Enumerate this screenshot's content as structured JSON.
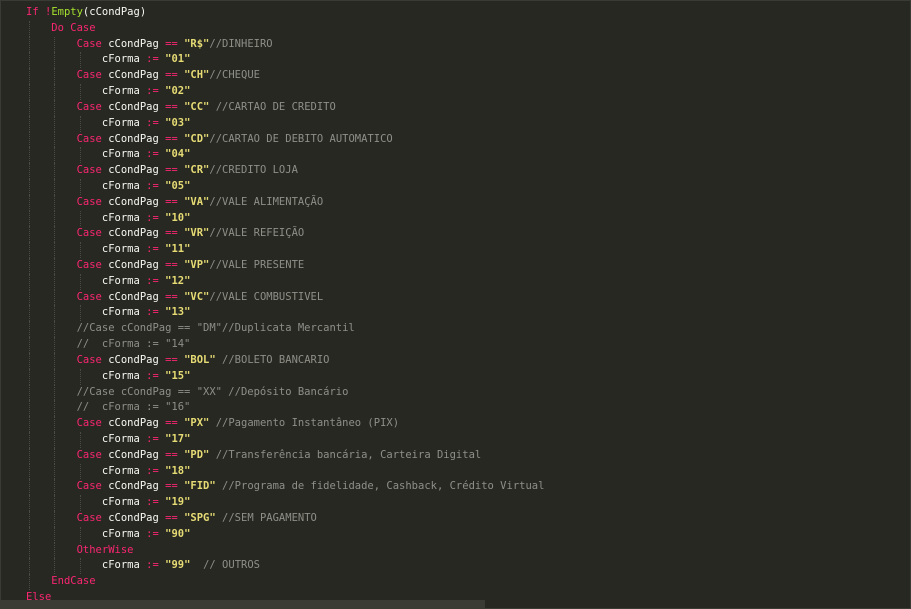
{
  "editor": {
    "lines": [
      {
        "indent": 1,
        "tokens": [
          [
            "kw",
            "If"
          ],
          [
            "id",
            " "
          ],
          [
            "op",
            "!"
          ],
          [
            "fn",
            "Empty"
          ],
          [
            "id",
            "(cCondPag)"
          ]
        ]
      },
      {
        "indent": 2,
        "tokens": [
          [
            "kw",
            "Do Case"
          ]
        ]
      },
      {
        "indent": 3,
        "tokens": [
          [
            "kw",
            "Case"
          ],
          [
            "id",
            " cCondPag "
          ],
          [
            "op",
            "=="
          ],
          [
            "id",
            " "
          ],
          [
            "str",
            "\"R$\""
          ],
          [
            "cm",
            "//DINHEIRO"
          ]
        ]
      },
      {
        "indent": 4,
        "tokens": [
          [
            "id",
            "cForma "
          ],
          [
            "op",
            ":="
          ],
          [
            "id",
            " "
          ],
          [
            "str",
            "\"01\""
          ]
        ]
      },
      {
        "indent": 3,
        "tokens": [
          [
            "kw",
            "Case"
          ],
          [
            "id",
            " cCondPag "
          ],
          [
            "op",
            "=="
          ],
          [
            "id",
            " "
          ],
          [
            "str",
            "\"CH\""
          ],
          [
            "cm",
            "//CHEQUE"
          ]
        ]
      },
      {
        "indent": 4,
        "tokens": [
          [
            "id",
            "cForma "
          ],
          [
            "op",
            ":="
          ],
          [
            "id",
            " "
          ],
          [
            "str",
            "\"02\""
          ]
        ]
      },
      {
        "indent": 3,
        "tokens": [
          [
            "kw",
            "Case"
          ],
          [
            "id",
            " cCondPag "
          ],
          [
            "op",
            "=="
          ],
          [
            "id",
            " "
          ],
          [
            "str",
            "\"CC\""
          ],
          [
            "id",
            " "
          ],
          [
            "cm",
            "//CARTAO DE CREDITO"
          ]
        ]
      },
      {
        "indent": 4,
        "tokens": [
          [
            "id",
            "cForma "
          ],
          [
            "op",
            ":="
          ],
          [
            "id",
            " "
          ],
          [
            "str",
            "\"03\""
          ]
        ]
      },
      {
        "indent": 3,
        "tokens": [
          [
            "kw",
            "Case"
          ],
          [
            "id",
            " cCondPag "
          ],
          [
            "op",
            "=="
          ],
          [
            "id",
            " "
          ],
          [
            "str",
            "\"CD\""
          ],
          [
            "cm",
            "//CARTAO DE DEBITO AUTOMATICO"
          ]
        ]
      },
      {
        "indent": 4,
        "tokens": [
          [
            "id",
            "cForma "
          ],
          [
            "op",
            ":="
          ],
          [
            "id",
            " "
          ],
          [
            "str",
            "\"04\""
          ]
        ]
      },
      {
        "indent": 3,
        "tokens": [
          [
            "kw",
            "Case"
          ],
          [
            "id",
            " cCondPag "
          ],
          [
            "op",
            "=="
          ],
          [
            "id",
            " "
          ],
          [
            "str",
            "\"CR\""
          ],
          [
            "cm",
            "//CREDITO LOJA"
          ]
        ]
      },
      {
        "indent": 4,
        "tokens": [
          [
            "id",
            "cForma "
          ],
          [
            "op",
            ":="
          ],
          [
            "id",
            " "
          ],
          [
            "str",
            "\"05\""
          ]
        ]
      },
      {
        "indent": 3,
        "tokens": [
          [
            "kw",
            "Case"
          ],
          [
            "id",
            " cCondPag "
          ],
          [
            "op",
            "=="
          ],
          [
            "id",
            " "
          ],
          [
            "str",
            "\"VA\""
          ],
          [
            "cm",
            "//VALE ALIMENTAÇÃO"
          ]
        ]
      },
      {
        "indent": 4,
        "tokens": [
          [
            "id",
            "cForma "
          ],
          [
            "op",
            ":="
          ],
          [
            "id",
            " "
          ],
          [
            "str",
            "\"10\""
          ]
        ]
      },
      {
        "indent": 3,
        "tokens": [
          [
            "kw",
            "Case"
          ],
          [
            "id",
            " cCondPag "
          ],
          [
            "op",
            "=="
          ],
          [
            "id",
            " "
          ],
          [
            "str",
            "\"VR\""
          ],
          [
            "cm",
            "//VALE REFEIÇÃO"
          ]
        ]
      },
      {
        "indent": 4,
        "tokens": [
          [
            "id",
            "cForma "
          ],
          [
            "op",
            ":="
          ],
          [
            "id",
            " "
          ],
          [
            "str",
            "\"11\""
          ]
        ]
      },
      {
        "indent": 3,
        "tokens": [
          [
            "kw",
            "Case"
          ],
          [
            "id",
            " cCondPag "
          ],
          [
            "op",
            "=="
          ],
          [
            "id",
            " "
          ],
          [
            "str",
            "\"VP\""
          ],
          [
            "cm",
            "//VALE PRESENTE"
          ]
        ]
      },
      {
        "indent": 4,
        "tokens": [
          [
            "id",
            "cForma "
          ],
          [
            "op",
            ":="
          ],
          [
            "id",
            " "
          ],
          [
            "str",
            "\"12\""
          ]
        ]
      },
      {
        "indent": 3,
        "tokens": [
          [
            "kw",
            "Case"
          ],
          [
            "id",
            " cCondPag "
          ],
          [
            "op",
            "=="
          ],
          [
            "id",
            " "
          ],
          [
            "str",
            "\"VC\""
          ],
          [
            "cm",
            "//VALE COMBUSTIVEL"
          ]
        ]
      },
      {
        "indent": 4,
        "tokens": [
          [
            "id",
            "cForma "
          ],
          [
            "op",
            ":="
          ],
          [
            "id",
            " "
          ],
          [
            "str",
            "\"13\""
          ]
        ]
      },
      {
        "indent": 3,
        "tokens": [
          [
            "cm",
            "//Case cCondPag == \"DM\"//Duplicata Mercantil"
          ]
        ]
      },
      {
        "indent": 3,
        "tokens": [
          [
            "cm",
            "//  cForma := \"14\""
          ]
        ]
      },
      {
        "indent": 3,
        "tokens": [
          [
            "kw",
            "Case"
          ],
          [
            "id",
            " cCondPag "
          ],
          [
            "op",
            "=="
          ],
          [
            "id",
            " "
          ],
          [
            "str",
            "\"BOL\""
          ],
          [
            "id",
            " "
          ],
          [
            "cm",
            "//BOLETO BANCARIO"
          ]
        ]
      },
      {
        "indent": 4,
        "tokens": [
          [
            "id",
            "cForma "
          ],
          [
            "op",
            ":="
          ],
          [
            "id",
            " "
          ],
          [
            "str",
            "\"15\""
          ]
        ]
      },
      {
        "indent": 3,
        "tokens": [
          [
            "cm",
            "//Case cCondPag == \"XX\" //Depósito Bancário"
          ]
        ]
      },
      {
        "indent": 3,
        "tokens": [
          [
            "cm",
            "//  cForma := \"16\""
          ]
        ]
      },
      {
        "indent": 3,
        "tokens": [
          [
            "kw",
            "Case"
          ],
          [
            "id",
            " cCondPag "
          ],
          [
            "op",
            "=="
          ],
          [
            "id",
            " "
          ],
          [
            "str",
            "\"PX\""
          ],
          [
            "id",
            " "
          ],
          [
            "cm",
            "//Pagamento Instantâneo (PIX)"
          ]
        ]
      },
      {
        "indent": 4,
        "tokens": [
          [
            "id",
            "cForma "
          ],
          [
            "op",
            ":="
          ],
          [
            "id",
            " "
          ],
          [
            "str",
            "\"17\""
          ]
        ]
      },
      {
        "indent": 3,
        "tokens": [
          [
            "kw",
            "Case"
          ],
          [
            "id",
            " cCondPag "
          ],
          [
            "op",
            "=="
          ],
          [
            "id",
            " "
          ],
          [
            "str",
            "\"PD\""
          ],
          [
            "id",
            " "
          ],
          [
            "cm",
            "//Transferência bancária, Carteira Digital"
          ]
        ]
      },
      {
        "indent": 4,
        "tokens": [
          [
            "id",
            "cForma "
          ],
          [
            "op",
            ":="
          ],
          [
            "id",
            " "
          ],
          [
            "str",
            "\"18\""
          ]
        ]
      },
      {
        "indent": 3,
        "tokens": [
          [
            "kw",
            "Case"
          ],
          [
            "id",
            " cCondPag "
          ],
          [
            "op",
            "=="
          ],
          [
            "id",
            " "
          ],
          [
            "str",
            "\"FID\""
          ],
          [
            "id",
            " "
          ],
          [
            "cm",
            "//Programa de fidelidade, Cashback, Crédito Virtual"
          ]
        ]
      },
      {
        "indent": 4,
        "tokens": [
          [
            "id",
            "cForma "
          ],
          [
            "op",
            ":="
          ],
          [
            "id",
            " "
          ],
          [
            "str",
            "\"19\""
          ]
        ]
      },
      {
        "indent": 3,
        "tokens": [
          [
            "kw",
            "Case"
          ],
          [
            "id",
            " cCondPag "
          ],
          [
            "op",
            "=="
          ],
          [
            "id",
            " "
          ],
          [
            "str",
            "\"SPG\""
          ],
          [
            "id",
            " "
          ],
          [
            "cm",
            "//SEM PAGAMENTO"
          ]
        ]
      },
      {
        "indent": 4,
        "tokens": [
          [
            "id",
            "cForma "
          ],
          [
            "op",
            ":="
          ],
          [
            "id",
            " "
          ],
          [
            "str",
            "\"90\""
          ]
        ]
      },
      {
        "indent": 3,
        "tokens": [
          [
            "kw",
            "OtherWise"
          ]
        ]
      },
      {
        "indent": 4,
        "tokens": [
          [
            "id",
            "cForma "
          ],
          [
            "op",
            ":="
          ],
          [
            "id",
            " "
          ],
          [
            "str",
            "\"99\""
          ],
          [
            "id",
            "  "
          ],
          [
            "cm",
            "// OUTROS"
          ]
        ]
      },
      {
        "indent": 2,
        "tokens": [
          [
            "kw",
            "EndCase"
          ]
        ]
      },
      {
        "indent": 1,
        "tokens": [
          [
            "kw",
            "Else"
          ]
        ]
      }
    ]
  }
}
